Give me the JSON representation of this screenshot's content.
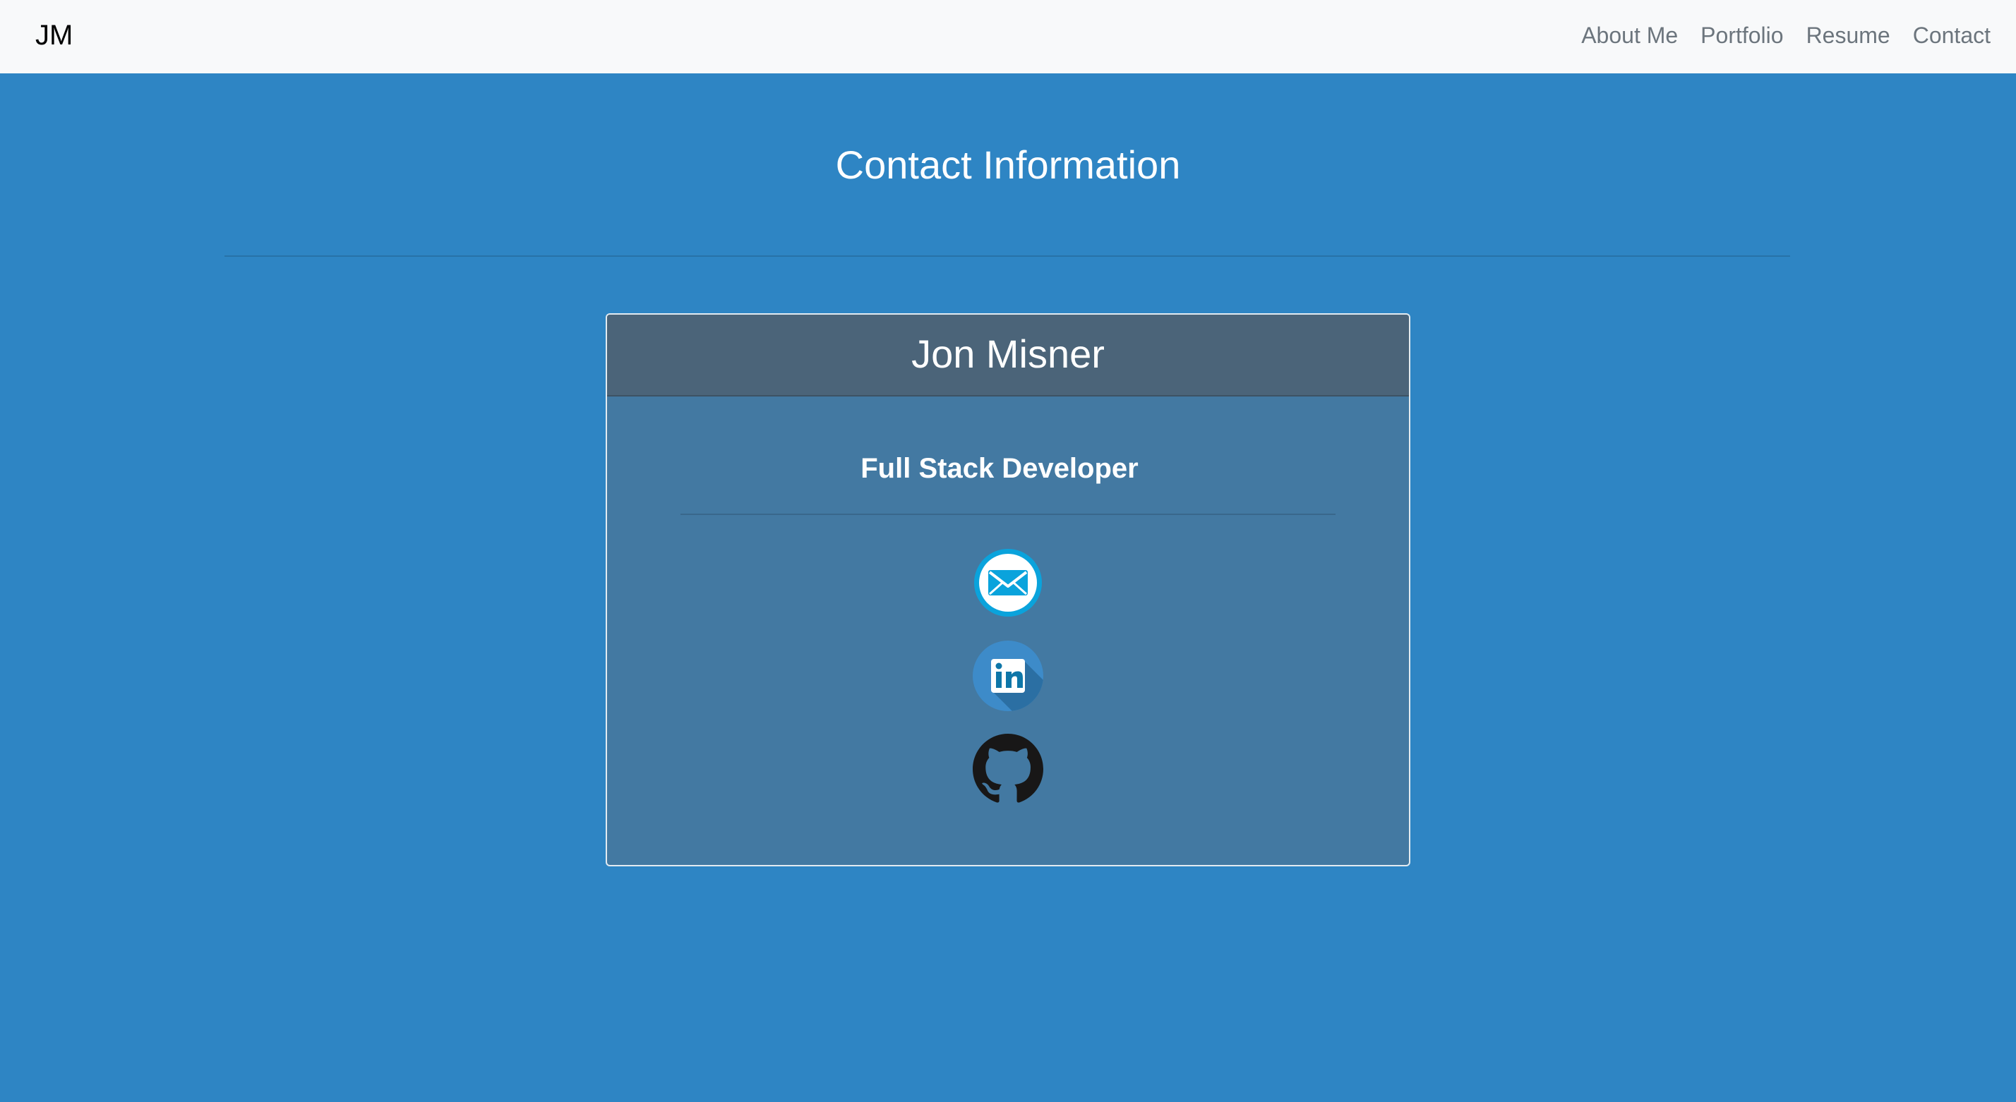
{
  "navbar": {
    "brand": "JM",
    "links": [
      "About Me",
      "Portfolio",
      "Resume",
      "Contact"
    ]
  },
  "main": {
    "title": "Contact Information"
  },
  "card": {
    "name": "Jon Misner",
    "role": "Full Stack Developer",
    "icons": [
      "envelope-icon",
      "linkedin-icon",
      "github-icon"
    ]
  },
  "colors": {
    "page_background": "#2e85c4",
    "navbar_background": "#f8f9fa",
    "card_header": "#4b6479",
    "card_body": "#4379a2",
    "email_icon_accent": "#0aa3dc",
    "linkedin_icon_circle": "#3d8bc9",
    "linkedin_icon_logo": "#0e76a8",
    "github_icon": "#181717"
  }
}
